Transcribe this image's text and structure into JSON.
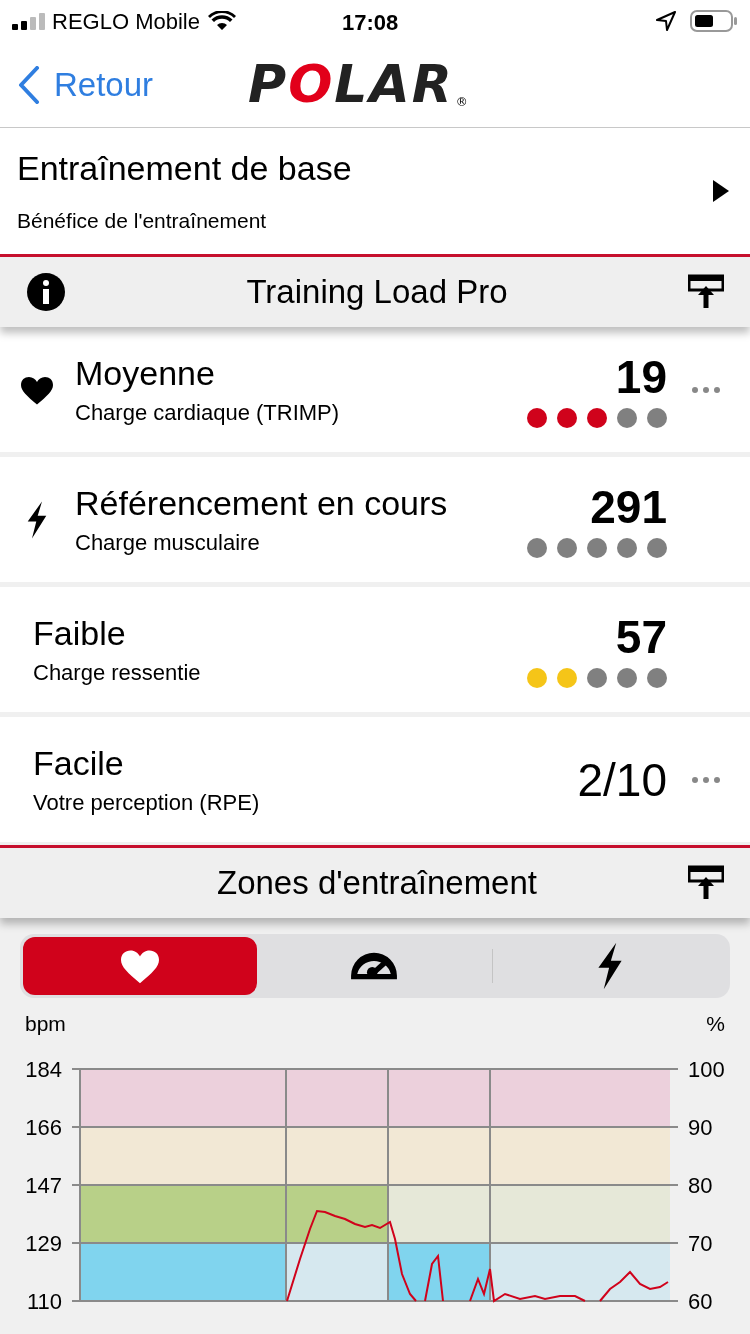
{
  "status_bar": {
    "carrier": "REGLO Mobile",
    "time": "17:08"
  },
  "nav": {
    "back": "Retour",
    "logo": "POLAR",
    "logo_mark": "®"
  },
  "workout": {
    "title": "Entraînement de base",
    "subtitle": "Bénéfice de l'entraînement"
  },
  "training_load": {
    "title": "Training Load Pro",
    "rows": [
      {
        "kind": "heart",
        "title": "Moyenne",
        "subtitle": "Charge cardiaque (TRIMP)",
        "value": "19",
        "menu": true,
        "dots": [
          {
            "color": "#d0021b"
          },
          {
            "color": "#d0021b"
          },
          {
            "color": "#d0021b"
          },
          {
            "color": "#808080"
          },
          {
            "color": "#808080"
          }
        ]
      },
      {
        "kind": "bolt",
        "title": "Référencement en cours",
        "subtitle": "Charge musculaire",
        "value": "291",
        "menu": false,
        "dots": [
          {
            "color": "#808080"
          },
          {
            "color": "#808080"
          },
          {
            "color": "#808080"
          },
          {
            "color": "#808080"
          },
          {
            "color": "#808080"
          }
        ]
      },
      {
        "kind": "plain",
        "title": "Faible",
        "subtitle": "Charge ressentie",
        "value": "57",
        "menu": false,
        "dots": [
          {
            "color": "#f5c518"
          },
          {
            "color": "#f5c518"
          },
          {
            "color": "#808080"
          },
          {
            "color": "#808080"
          },
          {
            "color": "#808080"
          }
        ]
      },
      {
        "kind": "plain",
        "title": "Facile",
        "subtitle": "Votre perception (RPE)",
        "value": "2/10",
        "menu": true,
        "dots": []
      }
    ]
  },
  "zones": {
    "title": "Zones d'entraînement",
    "tabs": [
      {
        "kind": "heart",
        "selected": true
      },
      {
        "kind": "gauge",
        "selected": false
      },
      {
        "kind": "bolt",
        "selected": false
      }
    ],
    "left_unit": "bpm",
    "right_unit": "%",
    "left_ticks": [
      "184",
      "166",
      "147",
      "129",
      "110"
    ],
    "right_ticks": [
      "100",
      "90",
      "80",
      "70",
      "60"
    ]
  }
}
